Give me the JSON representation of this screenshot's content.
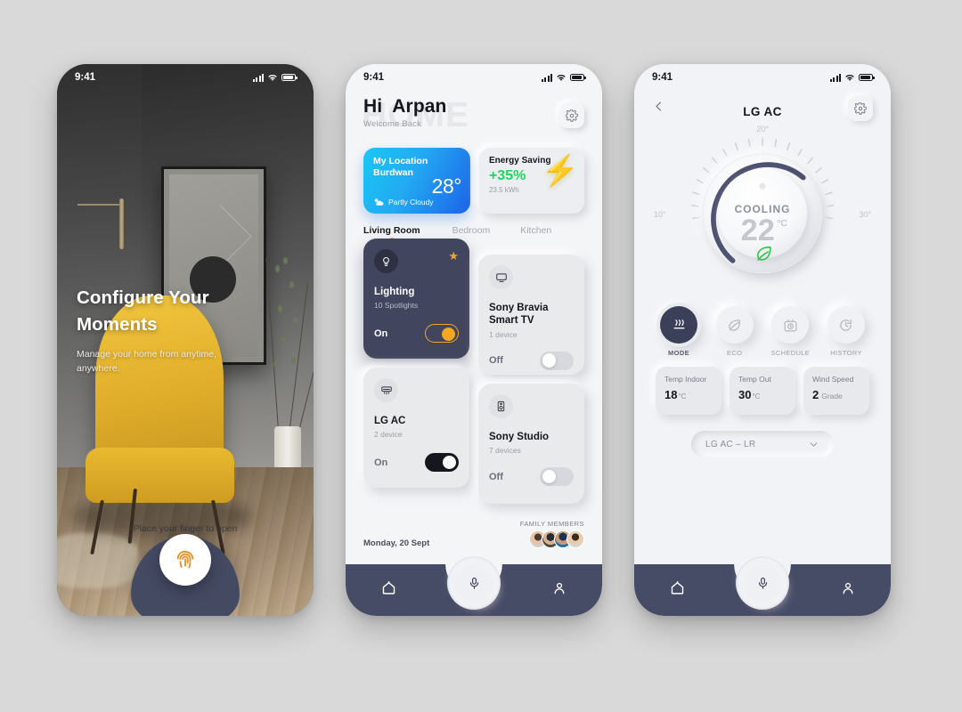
{
  "background_color": "#d9d9d9",
  "screen1": {
    "status": {
      "time": "9:41",
      "signal_icon": "signal-bars-icon",
      "wifi_icon": "wifi-icon",
      "battery_icon": "battery-icon"
    },
    "title_line1": "Configure Your",
    "title_line2": "Moments",
    "subtitle": "Manage your home from anytime, anywhere.",
    "hint": "Place your finger to open",
    "fingerprint_icon": "fingerprint-icon",
    "fingerprint_color": "#e8912a",
    "dip_color": "#454a63"
  },
  "screen2": {
    "status": {
      "time": "9:41"
    },
    "watermark": "HOME",
    "greeting_hi": "Hi",
    "greeting_name": "Arpan",
    "greeting_sub": "Welcome Back",
    "gear_icon": "gear-icon",
    "weather": {
      "label": "My Location",
      "city": "Burdwan",
      "temperature": "28°",
      "condition": "Partly Cloudy",
      "condition_icon": "partly-cloudy-icon",
      "gradient_from": "#19c8f5",
      "gradient_to": "#1d63e8"
    },
    "energy": {
      "title": "Energy Saving",
      "percent": "+35%",
      "kwh": "23.5 kWh",
      "bolt_icon": "lightning-bolt-icon",
      "accent": "#1ed760"
    },
    "rooms": [
      {
        "label": "Living Room",
        "active": true
      },
      {
        "label": "Bedroom",
        "active": false
      },
      {
        "label": "Kitchen",
        "active": false
      }
    ],
    "devices": [
      {
        "name": "Lighting",
        "sub": "10 Spotlights",
        "state": "On",
        "icon": "lightbulb-icon",
        "dark": true,
        "favorite": true,
        "toggle": "on-orange"
      },
      {
        "name": "LG AC",
        "sub": "2 device",
        "state": "On",
        "icon": "air-conditioner-icon",
        "dark": false,
        "favorite": false,
        "toggle": "on-black"
      },
      {
        "name": "Sony Bravia Smart TV",
        "sub": "1 device",
        "state": "Off",
        "icon": "television-icon",
        "dark": false,
        "favorite": false,
        "toggle": "off"
      },
      {
        "name": "Sony Studio",
        "sub": "7 devices",
        "state": "Off",
        "icon": "speaker-icon",
        "dark": false,
        "favorite": false,
        "toggle": "off"
      }
    ],
    "date": "Monday, 20 Sept",
    "family_label": "FAMILY MEMBERS",
    "family_count": 4,
    "nav": {
      "home_icon": "home-icon",
      "mic_icon": "microphone-icon",
      "profile_icon": "person-icon",
      "bar_color": "#474c66"
    }
  },
  "screen3": {
    "status": {
      "time": "9:41"
    },
    "back_icon": "chevron-left-icon",
    "title": "LG AC",
    "gear_icon": "gear-icon",
    "dial": {
      "mode_label": "COOLING",
      "temperature": "22",
      "unit": "°C",
      "min_label": "10°",
      "mid_label": "20°",
      "max_label": "30°",
      "eco_leaf_icon": "leaf-icon",
      "leaf_color": "#2fc44a",
      "arc_color": "#4c5170"
    },
    "modes": [
      {
        "label": "MODE",
        "icon": "heat-waves-icon",
        "active": true
      },
      {
        "label": "ECO",
        "icon": "leaf-icon",
        "active": false
      },
      {
        "label": "SCHEDULE",
        "icon": "timer-camera-icon",
        "active": false
      },
      {
        "label": "HISTORY",
        "icon": "history-clock-icon",
        "active": false
      }
    ],
    "stats": [
      {
        "label": "Temp Indoor",
        "value": "18",
        "unit": "°C",
        "suffix": ""
      },
      {
        "label": "Temp Out",
        "value": "30",
        "unit": "°C",
        "suffix": ""
      },
      {
        "label": "Wind Speed",
        "value": "2",
        "unit": "",
        "suffix": "Grade"
      }
    ],
    "selector": {
      "value": "LG AC – LR",
      "chevron_icon": "chevron-down-icon"
    },
    "nav": {
      "home_icon": "home-icon",
      "mic_icon": "microphone-icon",
      "profile_icon": "person-icon"
    }
  }
}
